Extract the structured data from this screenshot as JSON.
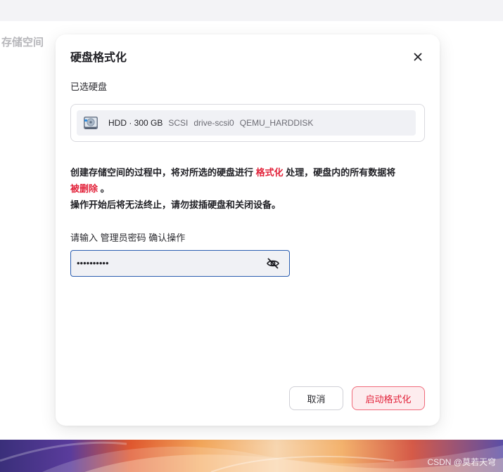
{
  "background": {
    "page_title": "存储空间",
    "watermark": "CSDN @莫若天穹"
  },
  "modal": {
    "title": "硬盘格式化",
    "close_icon": "close-icon",
    "selected_label": "已选硬盘",
    "disk": {
      "icon": "hard-disk-icon",
      "name": "HDD · 300 GB",
      "meta": [
        "SCSI",
        "drive-scsi0",
        "QEMU_HARDDISK"
      ]
    },
    "warning": {
      "part1": "创建存储空间的过程中，将对所选的硬盘进行 ",
      "highlight1": "格式化",
      "part2": " 处理，硬盘内的所有数据将",
      "highlight2": "被删除",
      "part3": " 。",
      "line2": "操作开始后将无法终止，请勿拔插硬盘和关闭设备。"
    },
    "password": {
      "label": "请输入 管理员密码 确认操作",
      "value": "••••••••••",
      "toggle_icon": "eye-off-icon"
    },
    "buttons": {
      "cancel": "取消",
      "confirm": "启动格式化"
    }
  },
  "colors": {
    "danger": "#e2223a",
    "input_border": "#2a5db0",
    "primary_bg": "#fdecee"
  }
}
